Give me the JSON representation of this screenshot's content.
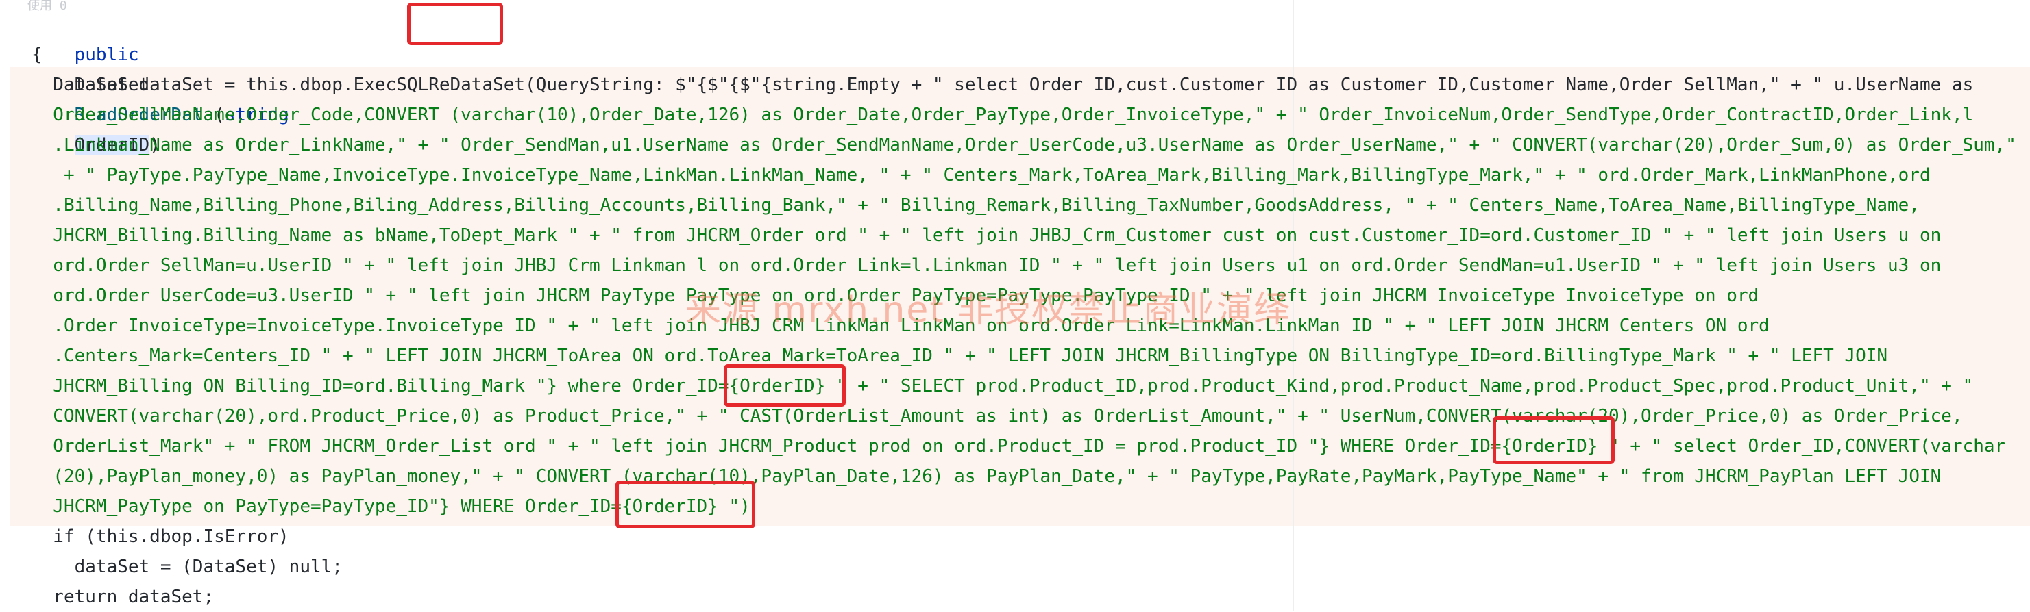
{
  "editor": {
    "ghost_text": "使用 0",
    "method": {
      "kw_public": "public",
      "return_type": "DataSet",
      "name": "ReadOrderData",
      "open": "(",
      "param_type": "string",
      "param": "OrderID",
      "close": ")"
    },
    "open_brace": "{",
    "lines": [
      {
        "text": "  DataSet dataSet = this.dbop.ExecSQLReDataSet(QueryString: $\"{$\"{$\"{string.Empty + \" select Order_ID,cust.Customer_ID as Customer_ID,Customer_Name,Order_SellMan,\" + \" u.UserName as"
      },
      {
        "text": "  Order_SellManName,Order_Code,CONVERT (varchar(10),Order_Date,126) as Order_Date,Order_PayType,Order_InvoiceType,\" + \" Order_InvoiceNum,Order_SendType,Order_ContractID,Order_Link,l"
      },
      {
        "text": "  .Linkman_Name as Order_LinkName,\" + \" Order_SendMan,u1.UserName as Order_SendManName,Order_UserCode,u3.UserName as Order_UserName,\" + \" CONVERT(varchar(20),Order_Sum,0) as Order_Sum,\""
      },
      {
        "text": "   + \" PayType.PayType_Name,InvoiceType.InvoiceType_Name,LinkMan.LinkMan_Name, \" + \" Centers_Mark,ToArea_Mark,Billing_Mark,BillingType_Mark,\" + \" ord.Order_Mark,LinkManPhone,ord"
      },
      {
        "text": "  .Billing_Name,Billing_Phone,Biling_Address,Billing_Accounts,Billing_Bank,\" + \" Billing_Remark,Billing_TaxNumber,GoodsAddress, \" + \" Centers_Name,ToArea_Name,BillingType_Name,"
      },
      {
        "text": "  JHCRM_Billing.Billing_Name as bName,ToDept_Mark \" + \" from JHCRM_Order ord \" + \" left join JHBJ_Crm_Customer cust on cust.Customer_ID=ord.Customer_ID \" + \" left join Users u on"
      },
      {
        "text": "  ord.Order_SellMan=u.UserID \" + \" left join JHBJ_Crm_Linkman l on ord.Order_Link=l.Linkman_ID \" + \" left join Users u1 on ord.Order_SendMan=u1.UserID \" + \" left join Users u3 on"
      },
      {
        "text": "  ord.Order_UserCode=u3.UserID \" + \" left join JHCRM_PayType PayType on ord.Order_PayType=PayType.PayType_ID \" + \" left join JHCRM_InvoiceType InvoiceType on ord"
      },
      {
        "text": "  .Order_InvoiceType=InvoiceType.InvoiceType_ID \" + \" left join JHBJ_CRM_LinkMan LinkMan on ord.Order_Link=LinkMan.LinkMan_ID \" + \" LEFT JOIN JHCRM_Centers ON ord"
      },
      {
        "text": "  .Centers_Mark=Centers_ID \" + \" LEFT JOIN JHCRM_ToArea ON ord.ToArea_Mark=ToArea_ID \" + \" LEFT JOIN JHCRM_BillingType ON BillingType_ID=ord.BillingType_Mark \" + \" LEFT JOIN"
      },
      {
        "text": "  JHCRM_Billing ON Billing_ID=ord.Billing_Mark \"} where Order_ID={OrderID} \" + \" SELECT prod.Product_ID,prod.Product_Kind,prod.Product_Name,prod.Product_Spec,prod.Product_Unit,\" + \""
      },
      {
        "text": "  CONVERT(varchar(20),ord.Product_Price,0) as Product_Price,\" + \" CAST(OrderList_Amount as int) as OrderList_Amount,\" + \" UserNum,CONVERT(varchar(20),Order_Price,0) as Order_Price,"
      },
      {
        "text": "  OrderList_Mark\" + \" FROM JHCRM_Order_List ord \" + \" left join JHCRM_Product prod on ord.Product_ID = prod.Product_ID \"} WHERE Order_ID={OrderID} \" + \" select Order_ID,CONVERT(varchar"
      },
      {
        "text": "  (20),PayPlan_money,0) as PayPlan_money,\" + \" CONVERT (varchar(10),PayPlan_Date,126) as PayPlan_Date,\" + \" PayType,PayRate,PayMark,PayType_Name\" + \" from JHCRM_PayPlan LEFT JOIN"
      },
      {
        "text": "  JHCRM_PayType on PayType=PayType_ID\"} WHERE Order_ID={OrderID} \")"
      }
    ],
    "tail": [
      {
        "text": "  if (this.dbop.IsError)"
      },
      {
        "text": "    dataSet = (DataSet) null;"
      },
      {
        "text": "  return dataSet;"
      }
    ],
    "watermark": "来源 mrxh.net 非授权禁止商业演绎"
  },
  "colors": {
    "keyword": "#0033b3",
    "method": "#00627a",
    "string": "#067d17",
    "highlight_box": "#e4282c",
    "background_band": "#fdf4ef"
  }
}
